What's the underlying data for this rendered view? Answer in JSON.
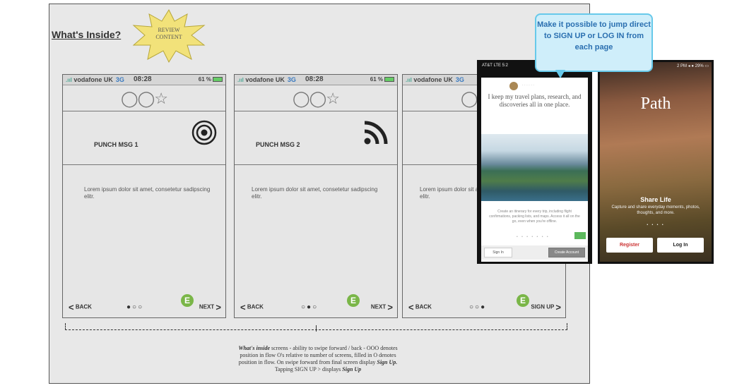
{
  "page": {
    "title": "What's Inside?",
    "review_badge": "REVIEW CONTENT"
  },
  "status_bar": {
    "carrier": "vodafone UK",
    "network": "3G",
    "time": "08:28",
    "battery": "61 %"
  },
  "screens": [
    {
      "icons": "◯◯☆",
      "punch_msg": "PUNCH MSG 1",
      "picture_icon": "target-icon",
      "body": "Lorem ipsum dolor sit amet, consetetur sadipscing elitr.",
      "back_label": "BACK",
      "dots": "●○○",
      "next_label": "NEXT"
    },
    {
      "icons": "◯◯☆",
      "punch_msg": "PUNCH MSG 2",
      "picture_icon": "rss-feed-icon",
      "body": "Lorem ipsum dolor sit amet, consetetur sadipscing elitr.",
      "back_label": "BACK",
      "dots": "○●○",
      "next_label": "NEXT"
    },
    {
      "icons": "◯◯☆",
      "punch_msg": "",
      "picture_icon": "",
      "body": "Lorem ipsum dolor sit amet, consetetur sadipscing elitr.",
      "back_label": "BACK",
      "dots": "○○●",
      "next_label": "SIGN UP"
    }
  ],
  "caption": {
    "line1_em": "What's inside",
    "line1_rest": " screens - ability to swipe forward / back - OOO denotes",
    "line2": "position in flow O's relative to number of screens, filled in O denotes",
    "line3_pre": "position in flow. On swipe forward from final screen display ",
    "line3_em": "Sign Up.",
    "line4_pre": "Tapping SIGN UP > displays ",
    "line4_em": "Sign Up"
  },
  "callout": {
    "text": "Make it possible to jump direct to SIGN UP or LOG IN from each page"
  },
  "reference_app_1": {
    "status": "AT&T LTE 5:2",
    "quote": "I keep my travel plans, research, and discoveries all in one place.",
    "description": "Create an itinerary for every trip, including flight confirmations, packing lists, and maps. Access it all on the go, even when you're offline.",
    "sign_in": "Sign In",
    "create_account": "Create Account"
  },
  "reference_app_2": {
    "status": "2 PM ◂ ● 29% ▭",
    "logo": "Path",
    "headline": "Share Life",
    "subtitle": "Capture and share everyday moments, photos, thoughts, and more.",
    "register": "Register",
    "login": "Log In"
  },
  "colors": {
    "badge_green": "#7ab648",
    "callout_bg": "#cfeefa",
    "callout_border": "#67c9ea",
    "callout_text": "#2a6fb0",
    "register_red": "#c33333"
  }
}
